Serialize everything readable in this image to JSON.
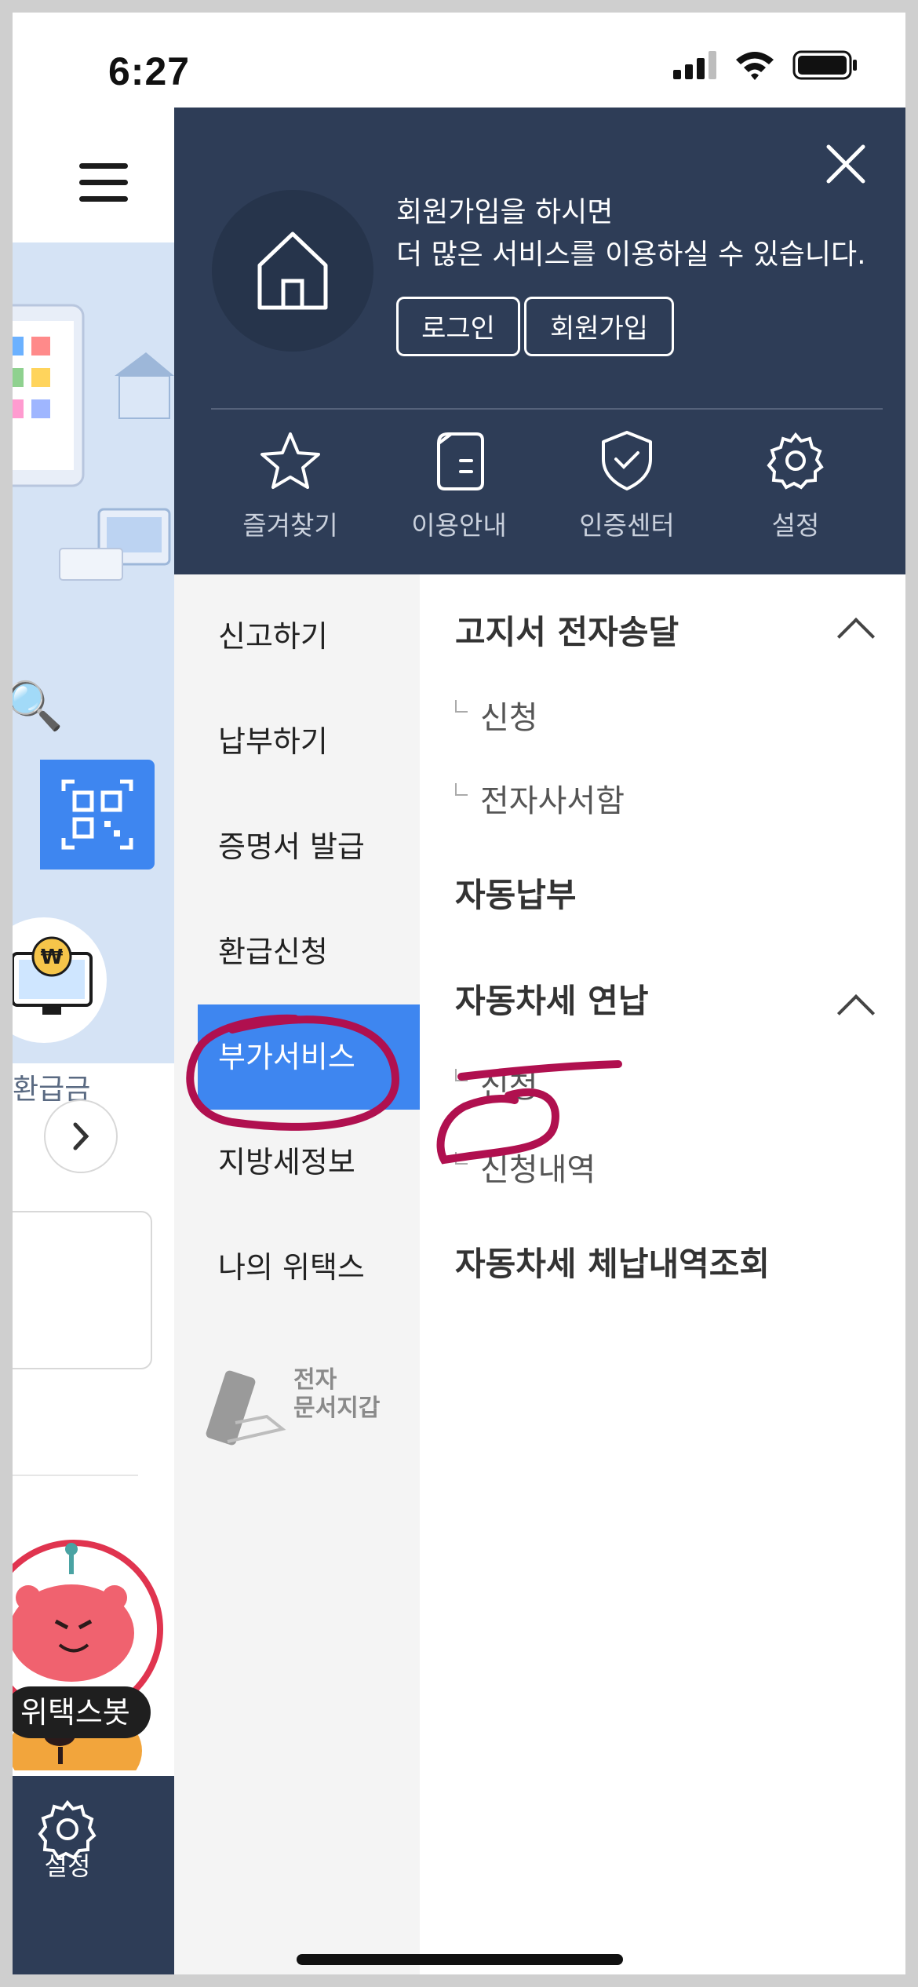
{
  "status": {
    "time": "6:27"
  },
  "background": {
    "refund_label": "환급금",
    "bot_label": "위택스봇",
    "settings_label": "설정"
  },
  "drawer": {
    "welcome_line1": "회원가입을 하시면",
    "welcome_line2": "더 많은 서비스를 이용하실 수 있습니다.",
    "login_label": "로그인",
    "signup_label": "회원가입",
    "quick_links": [
      {
        "label": "즐겨찾기",
        "icon": "star-icon"
      },
      {
        "label": "이용안내",
        "icon": "document-icon"
      },
      {
        "label": "인증센터",
        "icon": "shield-check-icon"
      },
      {
        "label": "설정",
        "icon": "gear-icon"
      }
    ],
    "menu": [
      {
        "label": "신고하기"
      },
      {
        "label": "납부하기"
      },
      {
        "label": "증명서 발급"
      },
      {
        "label": "환급신청"
      },
      {
        "label": "부가서비스",
        "active": true
      },
      {
        "label": "지방세정보"
      },
      {
        "label": "나의 위택스"
      }
    ],
    "wallet_line1": "전자",
    "wallet_line2": "문서지갑",
    "submenu": {
      "sec1_title": "고지서 전자송달",
      "sec1_item1": "신청",
      "sec1_item2": "전자사서함",
      "sec2_title": "자동납부",
      "sec3_title": "자동차세 연납",
      "sec3_item1": "신청",
      "sec3_item2": "신청내역",
      "sec4_title": "자동차세 체납내역조회"
    }
  },
  "colors": {
    "drawer_header": "#2e3d57",
    "accent": "#3e86f0",
    "annotation": "#b0104f"
  }
}
